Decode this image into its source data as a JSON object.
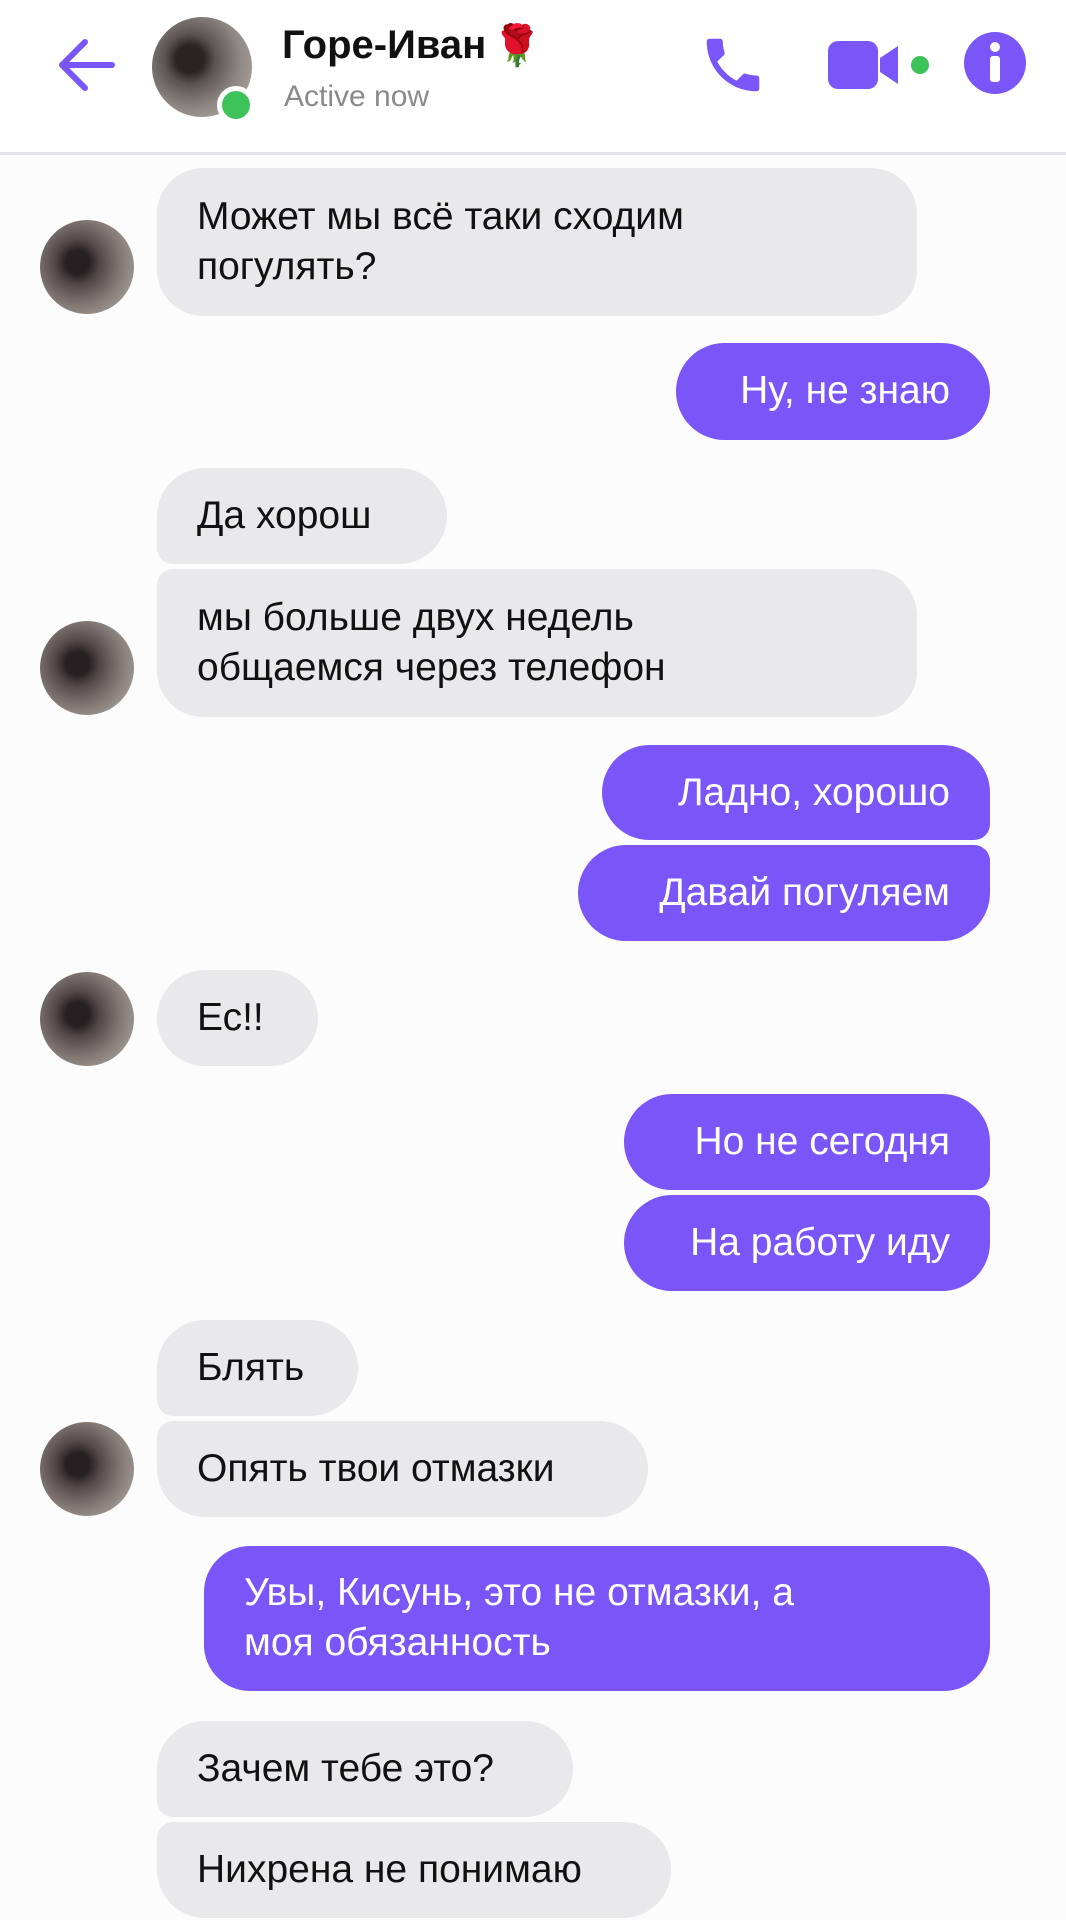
{
  "header": {
    "back_icon": "arrow-left-icon",
    "contact_name": "Горе-Иван",
    "contact_emoji": "🌹",
    "status": "Active now",
    "call_icon": "phone-icon",
    "video_icon": "video-camera-icon",
    "info_icon": "info-icon",
    "accent_color": "#7a55f8",
    "presence_color": "#3ec35a"
  },
  "messages": [
    {
      "from": "them",
      "text_lines": [
        "Может мы всё таки сходим",
        "погулять?"
      ]
    },
    {
      "from": "me",
      "text_lines": [
        "Ну, не знаю"
      ]
    },
    {
      "from": "them",
      "text_lines": [
        "Да хорош"
      ]
    },
    {
      "from": "them",
      "text_lines": [
        "мы больше двух недель",
        "общаемся через телефон"
      ]
    },
    {
      "from": "me",
      "text_lines": [
        "Ладно, хорошо"
      ]
    },
    {
      "from": "me",
      "text_lines": [
        "Давай погуляем"
      ]
    },
    {
      "from": "them",
      "text_lines": [
        "Ес!!"
      ]
    },
    {
      "from": "me",
      "text_lines": [
        "Но не сегодня"
      ]
    },
    {
      "from": "me",
      "text_lines": [
        "На работу иду"
      ]
    },
    {
      "from": "them",
      "text_lines": [
        "Блять"
      ]
    },
    {
      "from": "them",
      "text_lines": [
        "Опять твои отмазки"
      ]
    },
    {
      "from": "me",
      "text_lines": [
        "Увы, Кисунь, это не отмазки, а",
        "моя обязанность"
      ]
    },
    {
      "from": "them",
      "text_lines": [
        "Зачем тебе это?"
      ]
    },
    {
      "from": "them",
      "text_lines": [
        "Нихрена не понимаю"
      ]
    }
  ],
  "colors": {
    "incoming_bubble": "#e9e8eb",
    "outgoing_bubble": "#7a55f8"
  }
}
